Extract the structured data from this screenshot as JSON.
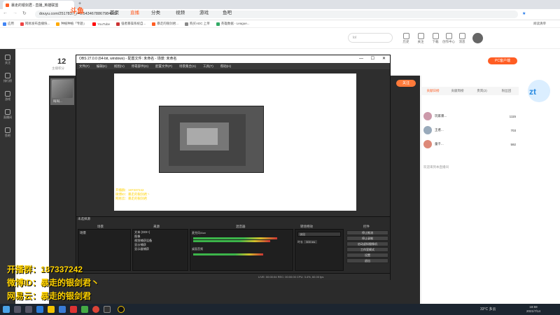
{
  "browser": {
    "tab_title": "暴走的银剑君 - 直播_英雄联盟",
    "url": "douyu.com/2517837_r=0.5434678867984009",
    "bookmarks": [
      "应用",
      "网易发布直播快...",
      "种植种植「专题」",
      "YouTube",
      "强者暴操系统自...",
      "暴走的银剑君...",
      "购买ADC 上单",
      "英雄数据 - League..."
    ],
    "reading_list": "阅读清单"
  },
  "header": {
    "logo": "斗鱼",
    "nav": [
      "首页",
      "直播",
      "分类",
      "视频",
      "游戏",
      "鱼吧"
    ],
    "search_placeholder": "lol",
    "icons": [
      "历史",
      "关注",
      "下载",
      "创作中心",
      "消息"
    ],
    "pc_button": "PC客户端"
  },
  "leftbar": [
    "关注",
    "排行榜",
    "游戏",
    "直播间",
    "鱼吧"
  ],
  "room": {
    "number": "12",
    "sub": "主播积分",
    "follow": "关注",
    "streamer_name": "叫叫..."
  },
  "obs": {
    "title": "OBS 27.0.0 (64-bit, windows) - 配置文件: 未命名 - 场景: 未命名",
    "menu": [
      "文件(F)",
      "编辑(E)",
      "视图(V)",
      "停靠部件(D)",
      "配置文件(P)",
      "场景集合(S)",
      "工具(T)",
      "帮助(H)"
    ],
    "overlay_lines": [
      "开播群：187337242",
      "微博ID：暴走的银剑君丶",
      "网易云：暴走的银剑君"
    ],
    "no_source": "未选择源",
    "docks": {
      "scenes": "场景",
      "sources": "来源",
      "mixer": "混音器",
      "transitions": "转场特效",
      "controls": "控件"
    },
    "scene_items": [
      "场景"
    ],
    "source_items": [
      "文本 (GDI+)",
      "图像",
      "视频捕获设备",
      "显示捕获",
      "显示器捕获"
    ],
    "mixer_channels": [
      "麦克风/Aux",
      "桌面音频"
    ],
    "transition_value": "淡出",
    "duration_label": "时长",
    "duration_value": "300 ms",
    "controls_buttons": [
      "停止推流",
      "停止录制",
      "启动虚拟摄像机",
      "工作室模式",
      "设置",
      "退出"
    ],
    "status": "LIVE: 00:00:04   REC: 00:00:00   CPU: 3.4%, 60.00 fps"
  },
  "right_panel": {
    "tabs": [
      "贡献日榜",
      "贡献周榜",
      "贵宾(2)",
      "粉丝团"
    ],
    "rank": [
      {
        "name": "玩家暴...",
        "score": "1115"
      },
      {
        "name": "王者...",
        "score": "703"
      },
      {
        "name": "童千...",
        "score": "592"
      }
    ],
    "chat_line": "欢迎来到本直播间"
  },
  "watermark": [
    "开播群：187337242",
    "微博ID：暴走的银剑君丶",
    "网易云：暴走的银剑君"
  ],
  "taskbar": {
    "temp": "33°C 多云",
    "time": "18:59",
    "date": "2021/7/14"
  },
  "colors": {
    "douyu_orange": "#ff5d23",
    "watermark_yellow": "#ffd200",
    "obs_bg": "#2e2e2e"
  }
}
